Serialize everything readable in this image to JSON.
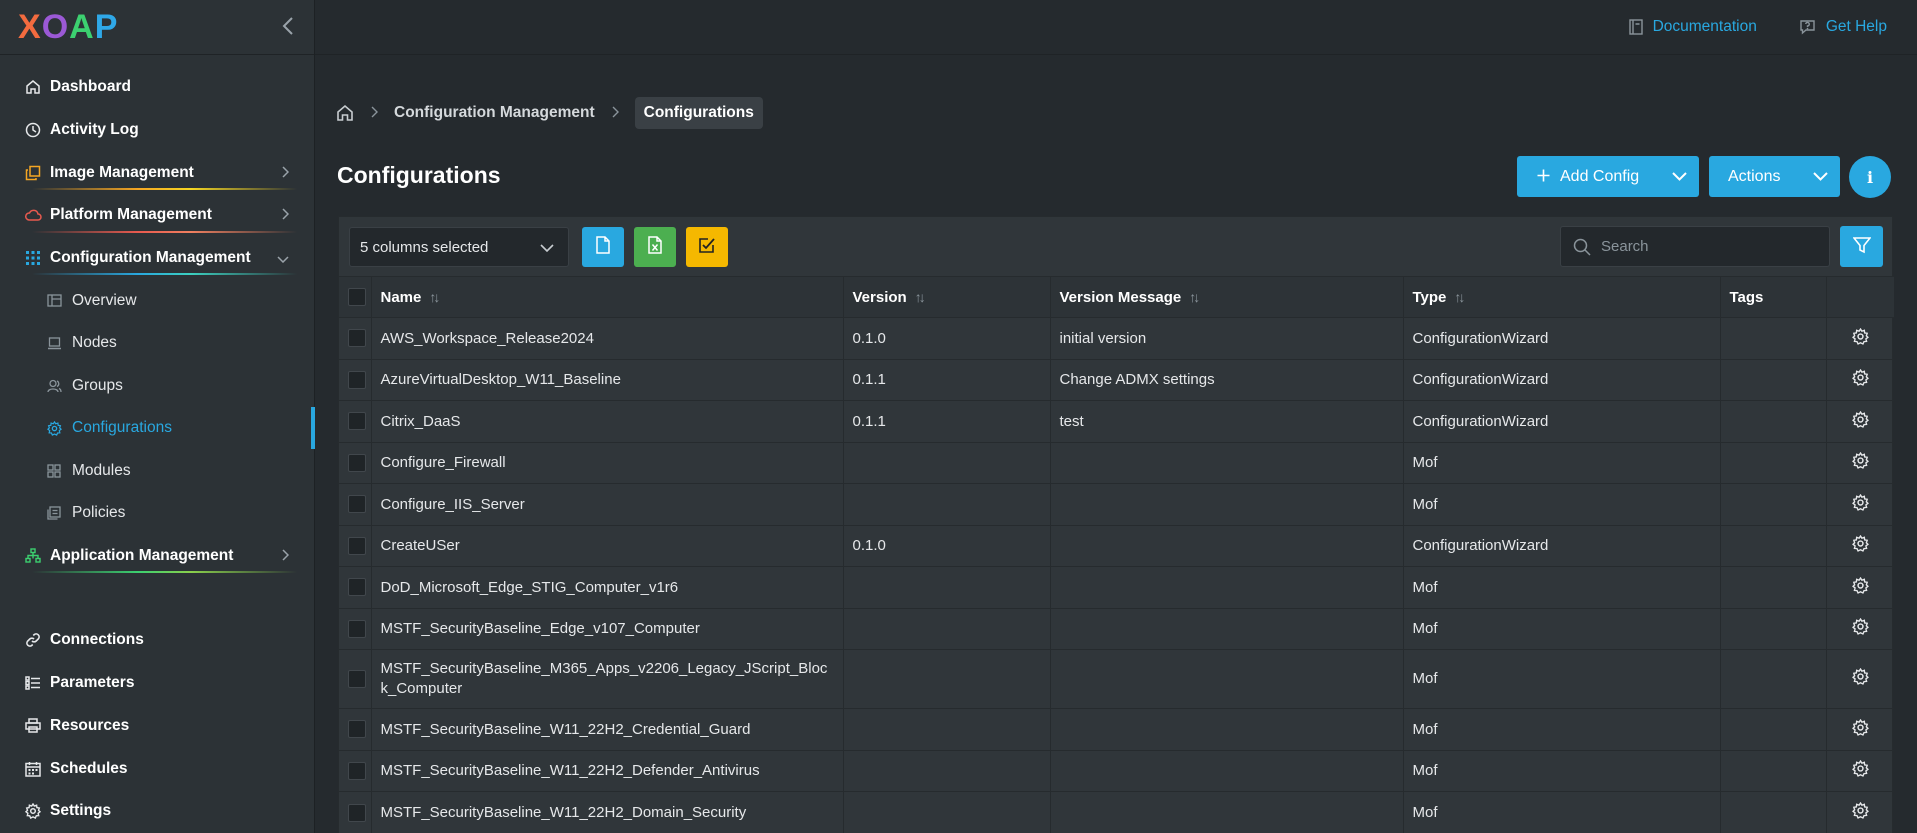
{
  "app": {
    "logo_letters": [
      "X",
      "O",
      "A",
      "P"
    ],
    "logo_colors": [
      "#f36b3f",
      "#9b59d6",
      "#3cd070",
      "#2fa8e8"
    ]
  },
  "colors": {
    "accent": "#29a8e0",
    "green": "#4caf50",
    "yellow": "#f5b800"
  },
  "topbar": {
    "documentation": "Documentation",
    "get_help": "Get Help"
  },
  "sidebar": {
    "items": [
      {
        "label": "Dashboard",
        "icon": "home-icon"
      },
      {
        "label": "Activity Log",
        "icon": "clock-icon"
      },
      {
        "label": "Image Management",
        "icon": "copy-icon"
      },
      {
        "label": "Platform Management",
        "icon": "cloud-icon"
      },
      {
        "label": "Configuration Management",
        "icon": "grid-icon"
      },
      {
        "label": "Application Management",
        "icon": "sitemap-icon"
      },
      {
        "label": "Connections",
        "icon": "link-icon"
      },
      {
        "label": "Parameters",
        "icon": "list-icon"
      },
      {
        "label": "Resources",
        "icon": "printer-icon"
      },
      {
        "label": "Schedules",
        "icon": "calendar-icon"
      },
      {
        "label": "Settings",
        "icon": "gear-icon"
      }
    ],
    "sub_items": [
      {
        "label": "Overview",
        "icon": "overview-icon"
      },
      {
        "label": "Nodes",
        "icon": "laptop-icon"
      },
      {
        "label": "Groups",
        "icon": "users-icon"
      },
      {
        "label": "Configurations",
        "icon": "gear-icon"
      },
      {
        "label": "Modules",
        "icon": "modules-icon"
      },
      {
        "label": "Policies",
        "icon": "policies-icon"
      }
    ]
  },
  "breadcrumb": {
    "parent": "Configuration Management",
    "current": "Configurations"
  },
  "page": {
    "title": "Configurations",
    "add_config": "Add Config",
    "actions": "Actions",
    "info": "i"
  },
  "toolbar": {
    "columns_selected": "5 columns selected",
    "search_placeholder": "Search"
  },
  "table": {
    "headers": {
      "name": "Name",
      "version": "Version",
      "version_message": "Version Message",
      "type": "Type",
      "tags": "Tags"
    },
    "rows": [
      {
        "name": "AWS_Workspace_Release2024",
        "version": "0.1.0",
        "message": "initial version",
        "type": "ConfigurationWizard",
        "tags": ""
      },
      {
        "name": "AzureVirtualDesktop_W11_Baseline",
        "version": "0.1.1",
        "message": "Change ADMX settings",
        "type": "ConfigurationWizard",
        "tags": ""
      },
      {
        "name": "Citrix_DaaS",
        "version": "0.1.1",
        "message": "test",
        "type": "ConfigurationWizard",
        "tags": ""
      },
      {
        "name": "Configure_Firewall",
        "version": "",
        "message": "",
        "type": "Mof",
        "tags": ""
      },
      {
        "name": "Configure_IIS_Server",
        "version": "",
        "message": "",
        "type": "Mof",
        "tags": ""
      },
      {
        "name": "CreateUSer",
        "version": "0.1.0",
        "message": "",
        "type": "ConfigurationWizard",
        "tags": ""
      },
      {
        "name": "DoD_Microsoft_Edge_STIG_Computer_v1r6",
        "version": "",
        "message": "",
        "type": "Mof",
        "tags": ""
      },
      {
        "name": "MSTF_SecurityBaseline_Edge_v107_Computer",
        "version": "",
        "message": "",
        "type": "Mof",
        "tags": ""
      },
      {
        "name": "MSTF_SecurityBaseline_M365_Apps_v2206_Legacy_JScript_Block_Computer",
        "version": "",
        "message": "",
        "type": "Mof",
        "tags": ""
      },
      {
        "name": "MSTF_SecurityBaseline_W11_22H2_Credential_Guard",
        "version": "",
        "message": "",
        "type": "Mof",
        "tags": ""
      },
      {
        "name": "MSTF_SecurityBaseline_W11_22H2_Defender_Antivirus",
        "version": "",
        "message": "",
        "type": "Mof",
        "tags": ""
      },
      {
        "name": "MSTF_SecurityBaseline_W11_22H2_Domain_Security",
        "version": "",
        "message": "",
        "type": "Mof",
        "tags": ""
      }
    ]
  }
}
